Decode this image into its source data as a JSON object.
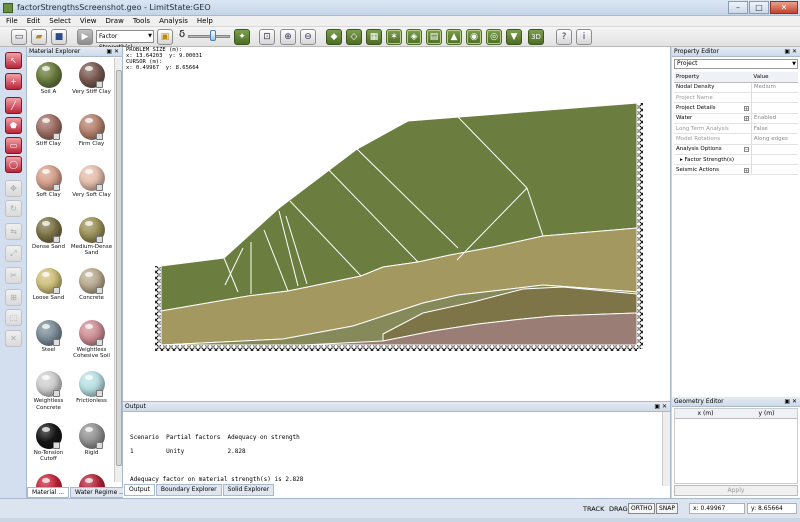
{
  "window": {
    "title": "factorStrengthsScreenshot.geo - LimitState:GEO",
    "minimize": "–",
    "maximize": "□",
    "close": "✕"
  },
  "menu": [
    "File",
    "Edit",
    "Select",
    "View",
    "Draw",
    "Tools",
    "Analysis",
    "Help"
  ],
  "toolbar": {
    "analysis_select": "Factor Strength(s)",
    "delta_symbol": "δ",
    "view3d_label": "3D",
    "help_label": "?",
    "info_label": "i"
  },
  "material_explorer": {
    "title": "Material Explorer",
    "materials": [
      {
        "name": "Soil A",
        "color": "#6b7d3f",
        "locked": false
      },
      {
        "name": "Very Stiff Clay",
        "color": "#7a5a52",
        "locked": true
      },
      {
        "name": "Stiff Clay",
        "color": "#a07066",
        "locked": true
      },
      {
        "name": "Firm Clay",
        "color": "#b68270",
        "locked": true
      },
      {
        "name": "Soft Clay",
        "color": "#d7a28e",
        "locked": true
      },
      {
        "name": "Very Soft Clay",
        "color": "#e6bfae",
        "locked": true
      },
      {
        "name": "Dense Sand",
        "color": "#7d7548",
        "locked": true
      },
      {
        "name": "Medium-Dense Sand",
        "color": "#9a9158",
        "locked": true
      },
      {
        "name": "Loose Sand",
        "color": "#cfc07c",
        "locked": true
      },
      {
        "name": "Concrete",
        "color": "#b9ab90",
        "locked": true
      },
      {
        "name": "Steel",
        "color": "#7e8e98",
        "locked": true
      },
      {
        "name": "Weightless Cohesive Soil",
        "color": "#cf8f96",
        "locked": true
      },
      {
        "name": "Weightless Concrete",
        "color": "#cfcfcf",
        "locked": true
      },
      {
        "name": "Frictionless",
        "color": "#b9e0e3",
        "locked": true
      },
      {
        "name": "No-Tension Cutoff",
        "color": "#161616",
        "locked": true
      },
      {
        "name": "Rigid",
        "color": "#939393",
        "locked": true
      },
      {
        "name": "",
        "color": "#c2263a",
        "locked": false
      },
      {
        "name": "",
        "color": "#b1263a",
        "locked": false
      }
    ],
    "tabs": [
      "Material ...",
      "Water Regime ..."
    ]
  },
  "canvas": {
    "problem_size_label": "PROBLEM SIZE (m):",
    "problem_size": "x: 13.64203  y: 9.00031",
    "cursor_label": "CURSOR (m):",
    "cursor": "x: 0.49967  y: 8.65664",
    "colors": {
      "top_layer": "#6b7d3f",
      "middle_layer": "#a39860",
      "lower_band": "#868a5a",
      "dark_band": "#7d7448",
      "bottom_layer": "#9a7d74"
    }
  },
  "output": {
    "title": "Output",
    "line1": "Scenario  Partial factors  Adequacy on strength",
    "line2": "1         Unity            2.828",
    "line3": "Adequacy factor on material strength(s) is 2.828",
    "tabs": [
      "Output",
      "Boundary Explorer",
      "Solid Explorer"
    ]
  },
  "property_editor": {
    "title": "Property Editor",
    "selection": "Project",
    "col_property": "Property",
    "col_value": "Value",
    "rows": [
      {
        "name": "Nodal Density",
        "value": "Medium"
      },
      {
        "name": "Project Name",
        "value": ""
      },
      {
        "name": "Project Details",
        "value": ""
      },
      {
        "name": "Water",
        "value": "Enabled"
      },
      {
        "name": "Long Term Analysis",
        "value": "False"
      },
      {
        "name": "Model Rotations",
        "value": "Along edges"
      },
      {
        "name": "Analysis Options",
        "value": ""
      },
      {
        "name": "Factor Strength(s)",
        "value": ""
      },
      {
        "name": "Seismic Actions",
        "value": ""
      }
    ]
  },
  "geometry_editor": {
    "title": "Geometry Editor",
    "col_x": "x (m)",
    "col_y": "y (m)",
    "apply": "Apply"
  },
  "status": {
    "track": "TRACK",
    "drag": "DRAG",
    "ortho": "ORTHO",
    "snap": "SNAP",
    "x": "x: 0.49967",
    "y": "y: 8.65664"
  }
}
